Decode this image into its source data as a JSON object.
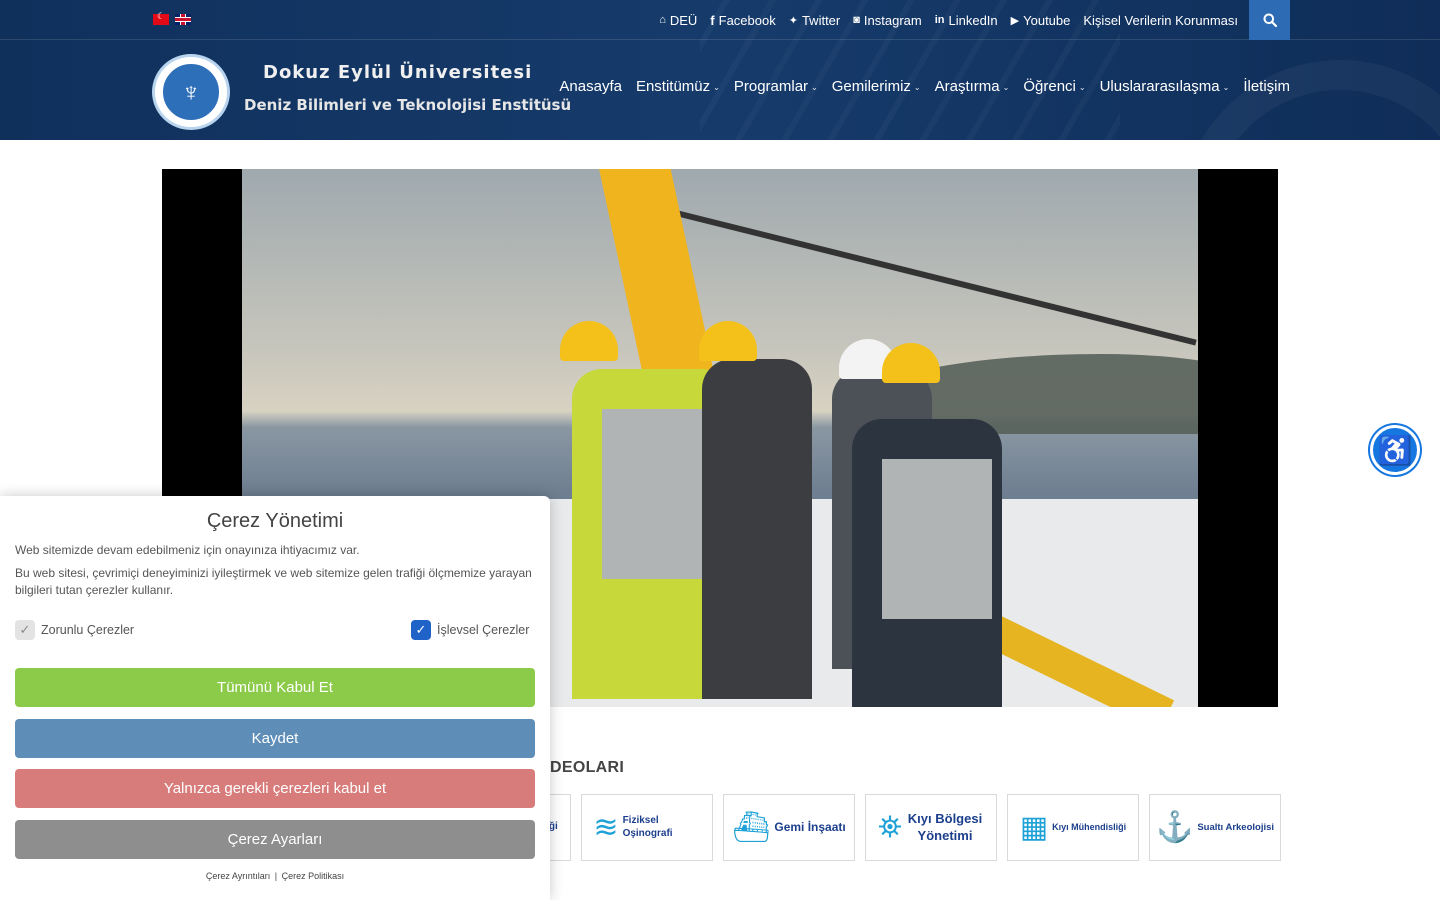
{
  "topbar": {
    "flags": [
      "turkish-flag-icon",
      "english-flag-icon"
    ],
    "links": [
      {
        "icon": "home-icon",
        "glyph": "⌂",
        "label": "DEÜ"
      },
      {
        "icon": "facebook-icon",
        "glyph": "f",
        "label": "Facebook"
      },
      {
        "icon": "twitter-icon",
        "glyph": "✦",
        "label": "Twitter"
      },
      {
        "icon": "instagram-icon",
        "glyph": "◙",
        "label": "Instagram"
      },
      {
        "icon": "linkedin-icon",
        "glyph": "in",
        "label": "LinkedIn"
      },
      {
        "icon": "youtube-icon",
        "glyph": "▶",
        "label": "Youtube"
      },
      {
        "icon": "",
        "glyph": "",
        "label": "Kişisel Verilerin Korunması"
      }
    ],
    "search_icon": "search-icon"
  },
  "brand": {
    "line1": "Dokuz Eylül Üniversitesi",
    "line2": "Deniz Bilimleri ve Teknolojisi Enstitüsü"
  },
  "nav": [
    {
      "label": "Anasayfa",
      "dropdown": false
    },
    {
      "label": "Enstitümüz",
      "dropdown": true
    },
    {
      "label": "Programlar",
      "dropdown": true
    },
    {
      "label": "Gemilerimiz",
      "dropdown": true
    },
    {
      "label": "Araştırma",
      "dropdown": true
    },
    {
      "label": "Öğrenci",
      "dropdown": true
    },
    {
      "label": "Uluslararasılaşma",
      "dropdown": true
    },
    {
      "label": "İletişim",
      "dropdown": false
    }
  ],
  "section": {
    "heading_visible": "DEOLARI"
  },
  "cards": [
    {
      "label": "jisi ği",
      "icon": "program-icon"
    },
    {
      "label": "Fiziksel Oşinografi",
      "icon": "wave-icon"
    },
    {
      "label": "Gemi İnşaatı",
      "icon": "ship-icon"
    },
    {
      "label": "Kıyı Bölgesi Yönetimi",
      "icon": "coastal-zone-icon"
    },
    {
      "label": "Kıyı Mühendisliği",
      "icon": "coastal-engineering-icon"
    },
    {
      "label": "Sualtı Arkeolojisi",
      "icon": "underwater-archaeology-icon"
    }
  ],
  "cookie": {
    "title": "Çerez Yönetimi",
    "text1": "Web sitemizde devam edebilmeniz için onayınıza ihtiyacımız var.",
    "text2": "Bu web sitesi, çevrimiçi deneyiminizi iyileştirmek ve web sitemize gelen trafiği ölçmemize yarayan bilgileri tutan çerezler kullanır.",
    "option_required": "Zorunlu Çerezler",
    "option_functional": "İşlevsel Çerezler",
    "accept_all": "Tümünü Kabul Et",
    "save": "Kaydet",
    "only_required": "Yalnızca gerekli çerezleri kabul et",
    "settings": "Çerez Ayarları",
    "link_details": "Çerez Ayrıntıları",
    "link_separator": "|",
    "link_policy": "Çerez Politikası"
  },
  "colors": {
    "header_bg": "#163b6b",
    "search_bg": "#2e6bb5",
    "accept": "#8ccb4a",
    "save": "#5e8db7",
    "only_required": "#d87b7b",
    "settings": "#8e8e8e",
    "accessibility": "#1677e0",
    "card_text": "#1c3f8c",
    "card_icon": "#1da1d6"
  }
}
